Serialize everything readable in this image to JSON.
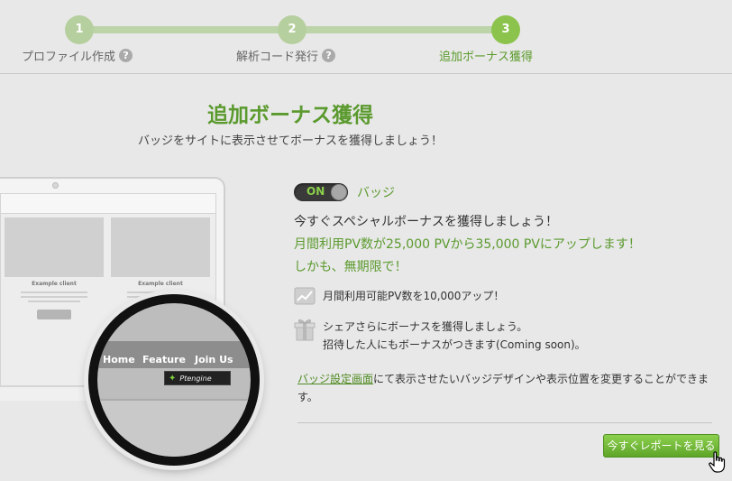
{
  "stepper": {
    "steps": [
      {
        "number": "1",
        "label": "プロファイル作成",
        "state": "done"
      },
      {
        "number": "2",
        "label": "解析コード発行",
        "state": "done"
      },
      {
        "number": "3",
        "label": "追加ボーナス獲得",
        "state": "active"
      }
    ],
    "help_glyph": "?"
  },
  "heading": {
    "title": "追加ボーナス獲得",
    "subtitle": "バッジをサイトに表示させてボーナスを獲得しましょう！"
  },
  "illustration": {
    "cards": [
      {
        "caption": "Example client"
      },
      {
        "caption": "Example client"
      }
    ],
    "nav": [
      "Home",
      "Feature",
      "Join Us"
    ],
    "badge_text": "Ptengine"
  },
  "badge_toggle": {
    "state": "ON",
    "label": "バッジ"
  },
  "offer": {
    "lead": "今すぐスペシャルボーナスを獲得しましょう！",
    "line1": "月間利用PV数が25,000 PVから35,000 PVにアップします！",
    "line2": "しかも、無期限で！"
  },
  "features": [
    {
      "icon": "chart-icon",
      "lines": [
        "月間利用可能PV数を10,000アップ！"
      ]
    },
    {
      "icon": "gift-icon",
      "lines": [
        "シェアさらにボーナスを獲得しましょう。",
        "招待した人にもボーナスがつきます(Coming soon)。"
      ]
    }
  ],
  "note": {
    "link_text": "バッジ設定画面",
    "text": "にて表示させたいバッジデザインや表示位置を変更することができます。"
  },
  "report_button": "今すぐレポートを見る",
  "colors": {
    "accent": "#5b9a2e",
    "button": "#6bb133",
    "background": "#e8e8e8"
  }
}
